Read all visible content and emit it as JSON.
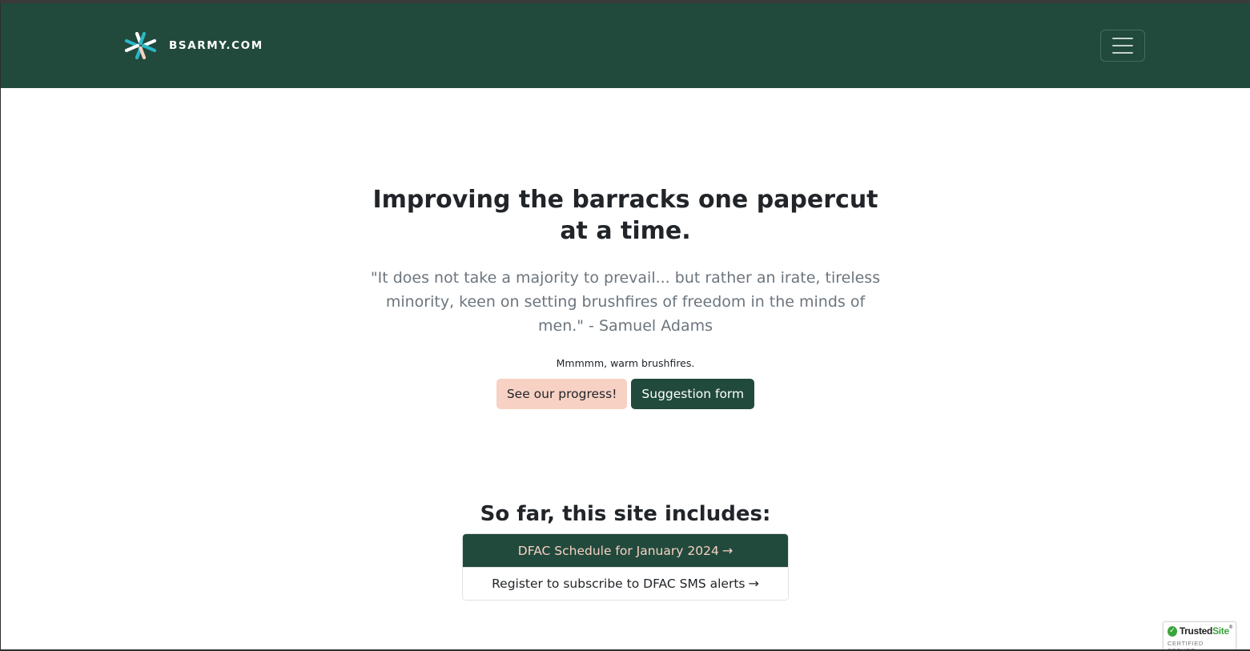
{
  "navbar": {
    "brand_text": "BSARMY.COM",
    "brand_icon": "asterisk-star-logo",
    "toggler_icon": "hamburger-menu-icon",
    "colors": {
      "background": "#214a3c",
      "logo_teal": "#2ab7c9",
      "logo_peach": "#f7d1c4",
      "logo_white": "#ffffff"
    }
  },
  "hero": {
    "title": "Improving the barracks one papercut at a time.",
    "quote": "\"It does not take a majority to prevail... but rather an irate, tireless minority, keen on setting brushfires of freedom in the minds of men.\" - Samuel Adams",
    "note": "Mmmmm, warm brushfires.",
    "buttons": {
      "progress_label": "See our progress!",
      "suggestion_label": "Suggestion form"
    }
  },
  "includes": {
    "heading": "So far, this site includes:",
    "items": [
      {
        "label": "DFAC Schedule for January 2024",
        "icon": "arrow-right-icon",
        "active": true
      },
      {
        "label": "Register to subscribe to DFAC SMS alerts",
        "icon": "arrow-right-icon",
        "active": false
      }
    ]
  },
  "trusted_seal": {
    "name_part1": "Trusted",
    "name_part2": "Site",
    "tm": "®",
    "subtitle": "CERTIFIED SECURE"
  }
}
